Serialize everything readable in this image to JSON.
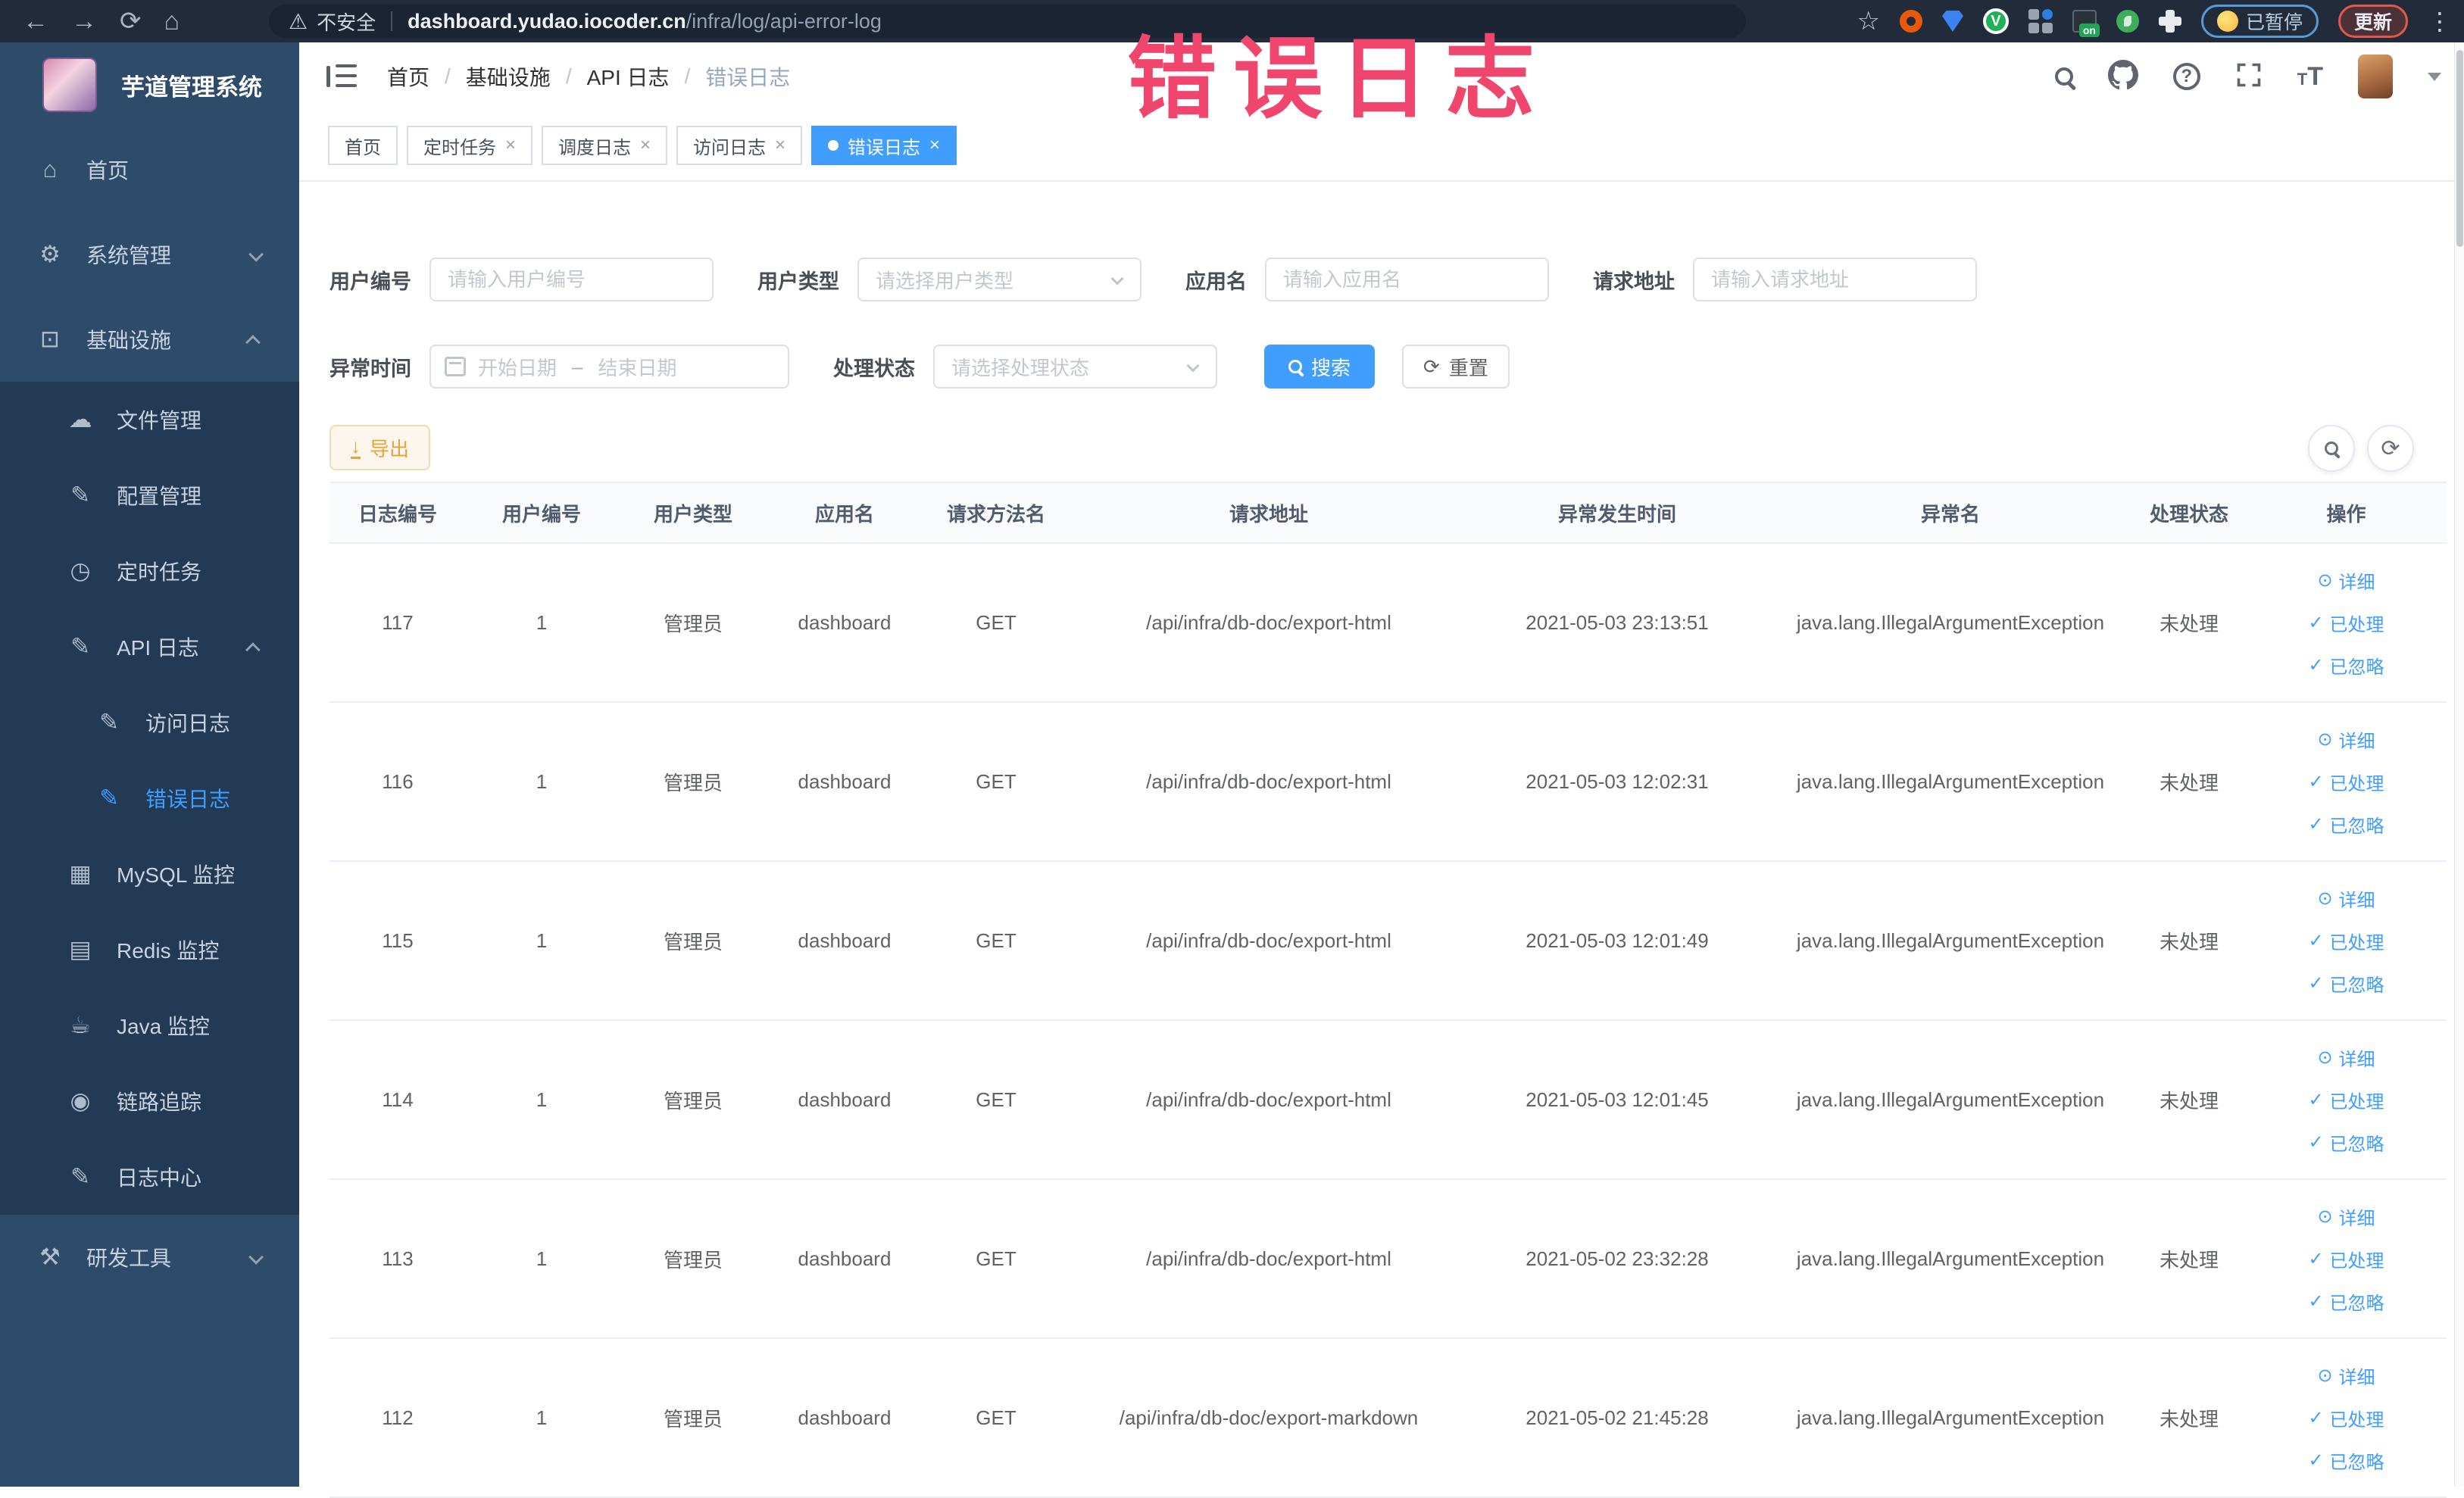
{
  "browser": {
    "security_warning": "不安全",
    "url_host": "dashboard.yudao.iocoder.cn",
    "url_path": "/infra/log/api-error-log",
    "paused_label": "已暂停",
    "update_label": "更新",
    "extension_icons": [
      "bookmark-star-icon",
      "orange-ring-extension-icon",
      "blue-shield-extension-icon",
      "green-v-extension-icon",
      "grid-extension-icon",
      "on-badge-extension-icon",
      "sprout-extension-icon",
      "puzzle-extensions-icon"
    ]
  },
  "annotation": {
    "text": "错误日志",
    "color": "#f0466e"
  },
  "sidebar": {
    "app_title": "芋道管理系统",
    "items": [
      {
        "name": "home",
        "label": "首页",
        "icon": "home",
        "level": 0,
        "sub": false
      },
      {
        "name": "system-management",
        "label": "系统管理",
        "icon": "gear",
        "level": 0,
        "sub": false,
        "chevron": "down"
      },
      {
        "name": "infrastructure",
        "label": "基础设施",
        "icon": "monitor",
        "level": 0,
        "sub": false,
        "chevron": "up"
      },
      {
        "name": "file-management",
        "label": "文件管理",
        "icon": "cloud",
        "level": 1,
        "sub": true
      },
      {
        "name": "config-management",
        "label": "配置管理",
        "icon": "edit",
        "level": 1,
        "sub": true
      },
      {
        "name": "scheduled-tasks",
        "label": "定时任务",
        "icon": "clock",
        "level": 1,
        "sub": true
      },
      {
        "name": "api-log",
        "label": "API 日志",
        "icon": "log",
        "level": 1,
        "sub": true,
        "chevron": "up"
      },
      {
        "name": "access-log",
        "label": "访问日志",
        "icon": "log",
        "level": 2,
        "sub": true
      },
      {
        "name": "error-log",
        "label": "错误日志",
        "icon": "log",
        "level": 2,
        "sub": true,
        "active": true
      },
      {
        "name": "mysql-monitor",
        "label": "MySQL 监控",
        "icon": "mysql",
        "level": 1,
        "sub": true
      },
      {
        "name": "redis-monitor",
        "label": "Redis 监控",
        "icon": "redis",
        "level": 1,
        "sub": true
      },
      {
        "name": "java-monitor",
        "label": "Java 监控",
        "icon": "java",
        "level": 1,
        "sub": true
      },
      {
        "name": "trace",
        "label": "链路追踪",
        "icon": "trace",
        "level": 1,
        "sub": true
      },
      {
        "name": "log-center",
        "label": "日志中心",
        "icon": "log",
        "level": 1,
        "sub": true
      },
      {
        "name": "dev-tools",
        "label": "研发工具",
        "icon": "tools",
        "level": 0,
        "sub": false,
        "chevron": "down"
      }
    ]
  },
  "breadcrumb": [
    "首页",
    "基础设施",
    "API 日志",
    "错误日志"
  ],
  "tabs": [
    {
      "label": "首页",
      "closable": false,
      "active": false
    },
    {
      "label": "定时任务",
      "closable": true,
      "active": false
    },
    {
      "label": "调度日志",
      "closable": true,
      "active": false
    },
    {
      "label": "访问日志",
      "closable": true,
      "active": false
    },
    {
      "label": "错误日志",
      "closable": true,
      "active": true
    }
  ],
  "filters": {
    "user_id": {
      "label": "用户编号",
      "placeholder": "请输入用户编号"
    },
    "user_type": {
      "label": "用户类型",
      "placeholder": "请选择用户类型"
    },
    "app_name": {
      "label": "应用名",
      "placeholder": "请输入应用名"
    },
    "request_url": {
      "label": "请求地址",
      "placeholder": "请输入请求地址"
    },
    "exception_time": {
      "label": "异常时间",
      "start_placeholder": "开始日期",
      "separator": "–",
      "end_placeholder": "结束日期"
    },
    "process_status": {
      "label": "处理状态",
      "placeholder": "请选择处理状态"
    },
    "search_label": "搜索",
    "reset_label": "重置"
  },
  "toolbar": {
    "export_label": "导出"
  },
  "table": {
    "columns": [
      "日志编号",
      "用户编号",
      "用户类型",
      "应用名",
      "请求方法名",
      "请求地址",
      "异常发生时间",
      "异常名",
      "处理状态",
      "操作"
    ],
    "row_actions": [
      {
        "label": "详细",
        "icon": "eye"
      },
      {
        "label": "已处理",
        "icon": "check"
      },
      {
        "label": "已忽略",
        "icon": "check"
      }
    ],
    "rows": [
      {
        "log_id": "117",
        "user_id": "1",
        "user_type": "管理员",
        "app_name": "dashboard",
        "method": "GET",
        "url": "/api/infra/db-doc/export-html",
        "time": "2021-05-03 23:13:51",
        "exception": "java.lang.IllegalArgumentException",
        "status": "未处理"
      },
      {
        "log_id": "116",
        "user_id": "1",
        "user_type": "管理员",
        "app_name": "dashboard",
        "method": "GET",
        "url": "/api/infra/db-doc/export-html",
        "time": "2021-05-03 12:02:31",
        "exception": "java.lang.IllegalArgumentException",
        "status": "未处理"
      },
      {
        "log_id": "115",
        "user_id": "1",
        "user_type": "管理员",
        "app_name": "dashboard",
        "method": "GET",
        "url": "/api/infra/db-doc/export-html",
        "time": "2021-05-03 12:01:49",
        "exception": "java.lang.IllegalArgumentException",
        "status": "未处理"
      },
      {
        "log_id": "114",
        "user_id": "1",
        "user_type": "管理员",
        "app_name": "dashboard",
        "method": "GET",
        "url": "/api/infra/db-doc/export-html",
        "time": "2021-05-03 12:01:45",
        "exception": "java.lang.IllegalArgumentException",
        "status": "未处理"
      },
      {
        "log_id": "113",
        "user_id": "1",
        "user_type": "管理员",
        "app_name": "dashboard",
        "method": "GET",
        "url": "/api/infra/db-doc/export-html",
        "time": "2021-05-02 23:32:28",
        "exception": "java.lang.IllegalArgumentException",
        "status": "未处理"
      },
      {
        "log_id": "112",
        "user_id": "1",
        "user_type": "管理员",
        "app_name": "dashboard",
        "method": "GET",
        "url": "/api/infra/db-doc/export-markdown",
        "time": "2021-05-02 21:45:28",
        "exception": "java.lang.IllegalArgumentException",
        "status": "未处理"
      }
    ]
  },
  "colors": {
    "primary": "#409eff",
    "sidebar_bg": "#2f4b6a",
    "sidebar_sub_bg": "#223a54",
    "warning_btn_text": "#e6a23c",
    "annotation_pink": "#f0466e"
  }
}
